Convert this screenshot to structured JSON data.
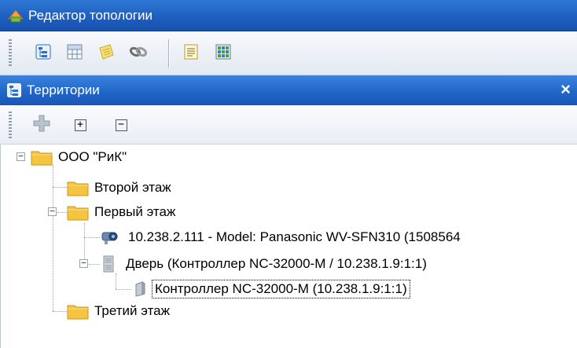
{
  "window": {
    "title": "Редактор топологии"
  },
  "panel": {
    "title": "Территории",
    "close": "×"
  },
  "toolbar2": {
    "expand": "+",
    "collapse": "−"
  },
  "tree": {
    "root": "ООО \"РиК\"",
    "floor2": "Второй этаж",
    "floor1": "Первый этаж",
    "camera": "10.238.2.111 - Model: Panasonic WV-SFN310 (1508564",
    "door": "Дверь (Контроллер NC-32000-M / 10.238.1.9:1:1)",
    "controller": "Контроллер NC-32000-M (10.238.1.9:1:1)",
    "floor3": "Третий этаж"
  },
  "colors": {
    "accent": "#1f64c6",
    "folder": "#f5c542",
    "border": "#bcc7d6"
  },
  "icons": [
    "topology-icon",
    "tree-view-icon",
    "grid-icon",
    "notes-icon",
    "link-icon",
    "document-icon",
    "map-icon",
    "add-icon",
    "folder-icon",
    "camera-icon",
    "door-icon",
    "controller-icon"
  ]
}
